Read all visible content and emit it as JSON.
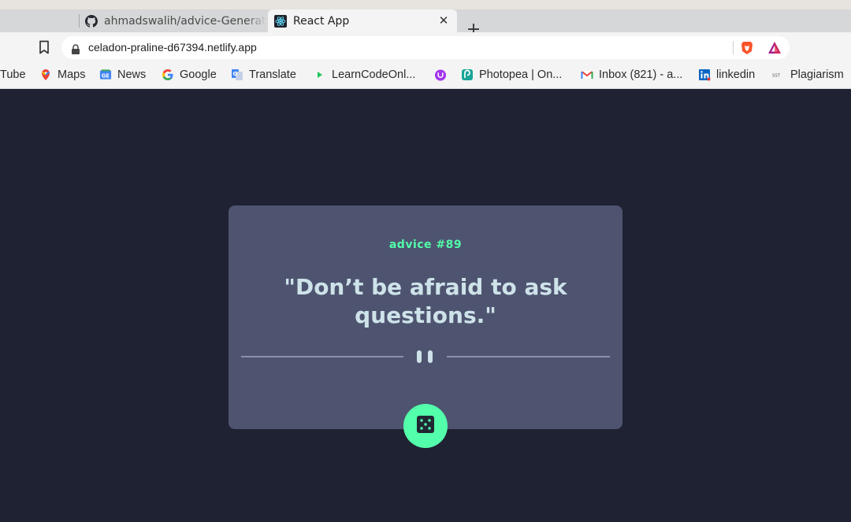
{
  "browser": {
    "tabs": [
      {
        "label": "ahmadswalih/advice-Generator",
        "icon": "github-icon",
        "active": false
      },
      {
        "label": "React App",
        "icon": "react-icon",
        "active": true
      }
    ],
    "tab_close_glyph": "✕",
    "new_tab_glyph": "+",
    "url": "celadon-praline-d67394.netlify.app",
    "bookmarks": [
      {
        "label": "Tube",
        "icon": "youtube-icon"
      },
      {
        "label": "Maps",
        "icon": "maps-icon"
      },
      {
        "label": "News",
        "icon": "news-icon"
      },
      {
        "label": "Google",
        "icon": "google-icon"
      },
      {
        "label": "Translate",
        "icon": "translate-icon"
      },
      {
        "label": "LearnCodeOnl...",
        "icon": "play-icon"
      },
      {
        "label": "",
        "icon": "udemy-icon"
      },
      {
        "label": "Photopea | On...",
        "icon": "photopea-icon"
      },
      {
        "label": "Inbox (821) - a...",
        "icon": "gmail-icon"
      },
      {
        "label": "linkedin",
        "icon": "linkedin-icon"
      },
      {
        "label": "Plagiarism",
        "icon": "sst-icon"
      }
    ]
  },
  "card": {
    "advice_id": "advice #89",
    "quote": "\"Don’t be afraid to ask questions.\"",
    "divider_icon": "pause-icon",
    "button_icon": "dice-icon"
  },
  "colors": {
    "page_bg": "#1f2232",
    "card_bg": "#4e5470",
    "accent": "#53ffaa",
    "quote_text": "#cee3e9",
    "divider": "#8a90a7"
  }
}
